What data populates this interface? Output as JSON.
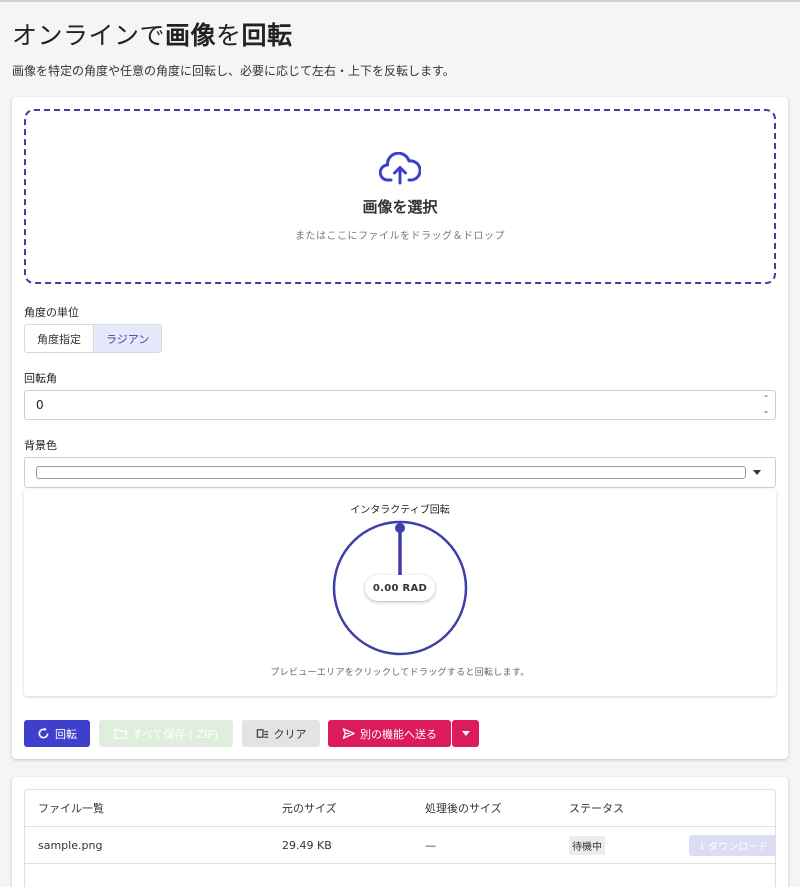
{
  "page": {
    "title_part1": "オンラインで",
    "title_part2": "画像",
    "title_part3": "を",
    "title_part4": "回転",
    "description": "画像を特定の角度や任意の角度に回転し、必要に応じて左右・上下を反転します。"
  },
  "dropzone": {
    "title": "画像を選択",
    "subtitle": "またはここにファイルをドラッグ＆ドロップ",
    "icon": "cloud-upload-icon"
  },
  "angle_unit": {
    "label": "角度の単位",
    "options": [
      "角度指定",
      "ラジアン"
    ],
    "selected": "ラジアン"
  },
  "rotation": {
    "label": "回転角",
    "value": "0"
  },
  "background": {
    "label": "背景色",
    "value": "#ffffff"
  },
  "interactive": {
    "title": "インタラクティブ回転",
    "readout": "0.00 RAD",
    "hint": "プレビューエリアをクリックしてドラッグすると回転します。",
    "angle": 0
  },
  "actions": {
    "rotate_label": "回転",
    "zip_label": "すべて保存 (.ZIP)",
    "clear_label": "クリア",
    "send_label": "別の機能へ送る"
  },
  "colors": {
    "primary": "#3f3fce",
    "accent": "#dc1a5e",
    "dial": "#3f3fa8"
  },
  "files": {
    "headers": [
      "ファイル一覧",
      "元のサイズ",
      "処理後のサイズ",
      "ステータス"
    ],
    "rows": [
      {
        "name": "sample.png",
        "original_size": "29.49 KB",
        "processed_size": "—",
        "status": "待機中",
        "download_label": "ダウンロード"
      }
    ]
  }
}
